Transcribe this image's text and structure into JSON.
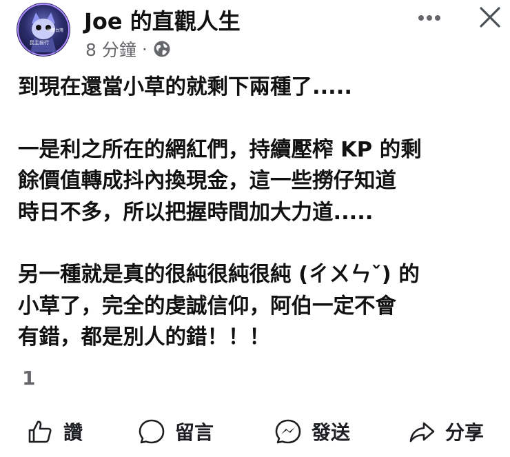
{
  "post": {
    "author": "Joe 的直觀人生",
    "time": "8 分鐘",
    "separator": "·",
    "avatar_text_left": "民主前行",
    "avatar_text_right": "共體台灣",
    "lines_p1": [
      "到現在還當小草的就剩下兩種了....."
    ],
    "lines_p2": [
      "一是利之所在的網紅們，持續壓榨 KP 的剩",
      "餘價值轉成抖內換現金，這一些撈仔知道",
      "時日不多，所以把握時間加大力道....."
    ],
    "lines_p3": [
      "另一種就是真的很純很純很純 (ㄔㄨㄣˇ) 的",
      "小草了，完全的虔誠信仰，阿伯一定不會",
      "有錯，都是別人的錯！！！"
    ],
    "reaction_count": "1"
  },
  "actions": {
    "like": "讚",
    "comment": "留言",
    "send": "發送",
    "share": "分享"
  },
  "icons": {
    "privacy": "globe-icon",
    "more": "more-horizontal-icon",
    "close": "close-icon",
    "like": "thumbs-up-icon",
    "comment": "comment-bubble-icon",
    "send": "messenger-icon",
    "share": "share-arrow-icon"
  }
}
